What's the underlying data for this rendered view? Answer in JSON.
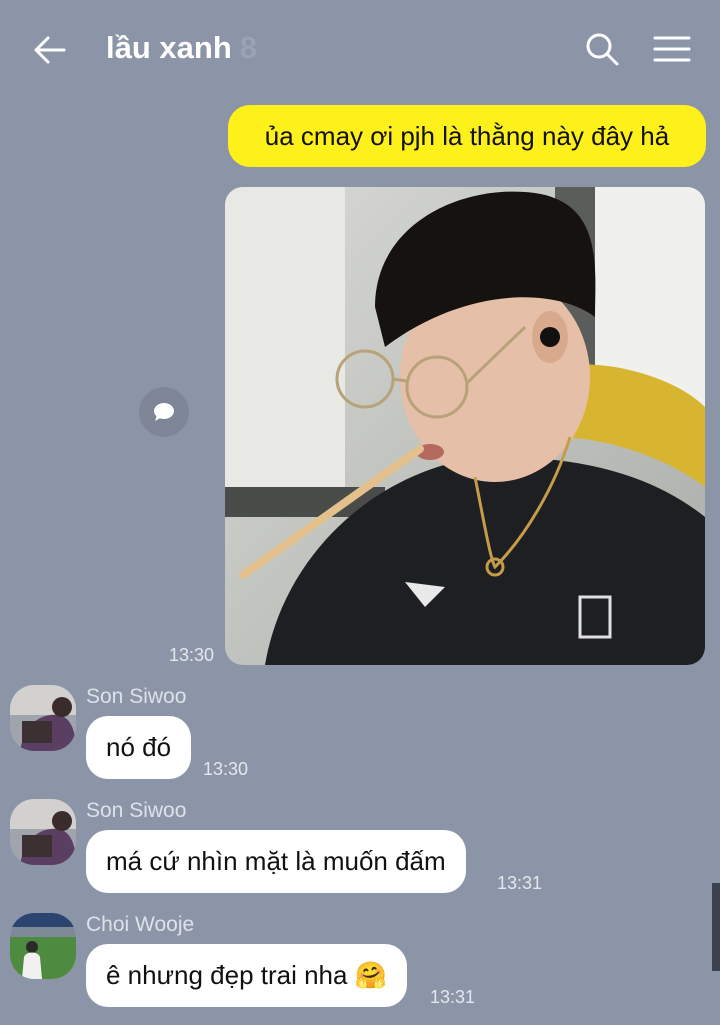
{
  "header": {
    "title": "lầu xanh",
    "member_count": "8"
  },
  "messages": [
    {
      "text": "ủa cmay ơi pjh là thằng này đây hả"
    },
    {
      "time": "13:30"
    },
    {
      "sender": "Son Siwoo",
      "text": "nó đó",
      "time": "13:30"
    },
    {
      "sender": "Son Siwoo",
      "text": "má cứ nhìn mặt là muốn đấm",
      "time": "13:31"
    },
    {
      "sender": "Choi Wooje",
      "text": "ê nhưng đẹp trai nha",
      "emoji": "🤗",
      "time": "13:31"
    }
  ],
  "icons": {
    "back": "arrow-left-icon",
    "search": "search-icon",
    "menu": "hamburger-menu-icon",
    "share": "speech-bubble-icon"
  },
  "colors": {
    "background": "#8c95a8",
    "my_bubble": "#fef01b",
    "their_bubble": "#ffffff"
  }
}
